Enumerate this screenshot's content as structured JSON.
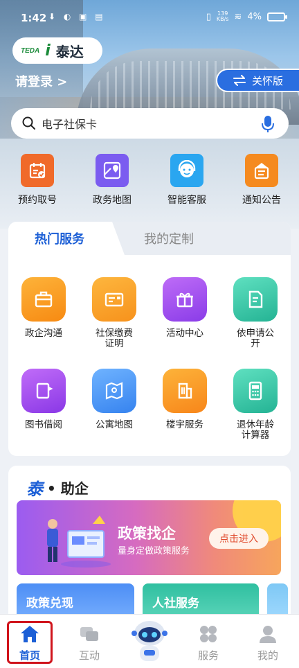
{
  "status_bar": {
    "time": "1:42",
    "network_speed": "139\nKB/s",
    "battery": "4%"
  },
  "header": {
    "logo_text": "TEDA",
    "app_name": "泰达",
    "login_text": "请登录 >",
    "care_mode_label": "关怀版"
  },
  "search": {
    "placeholder": "电子社保卡"
  },
  "quick_actions": [
    {
      "label": "预约取号",
      "icon": "calendar-check-icon",
      "color": "#f06a2a"
    },
    {
      "label": "政务地图",
      "icon": "map-pin-icon",
      "color": "#7b5cf0"
    },
    {
      "label": "智能客服",
      "icon": "headset-icon",
      "color": "#2aa6f0"
    },
    {
      "label": "通知公告",
      "icon": "notice-icon",
      "color": "#f58a1f"
    }
  ],
  "services": {
    "tabs": [
      "热门服务",
      "我的定制"
    ],
    "items": [
      {
        "label": "政企沟通",
        "icon": "briefcase-icon",
        "color": "#f89a1e"
      },
      {
        "label": "社保缴费\n证明",
        "icon": "card-icon",
        "color": "#f8a02a"
      },
      {
        "label": "活动中心",
        "icon": "gift-icon",
        "color": "#a24cf0"
      },
      {
        "label": "依申请公\n开",
        "icon": "document-icon",
        "color": "#36c9a8"
      },
      {
        "label": "图书借阅",
        "icon": "book-icon",
        "color": "#a04cf0"
      },
      {
        "label": "公寓地图",
        "icon": "map-icon",
        "color": "#3b8cf5"
      },
      {
        "label": "楼宇服务",
        "icon": "building-icon",
        "color": "#f8921e"
      },
      {
        "label": "退休年龄\n计算器",
        "icon": "calculator-icon",
        "color": "#2fbfa5"
      }
    ]
  },
  "assist": {
    "brand": "泰",
    "title": "• 助企",
    "banner": {
      "title": "政策找企",
      "subtitle": "量身定做政策服务",
      "cta": "点击进入"
    },
    "cards": [
      "政策兑现",
      "人社服务"
    ]
  },
  "bottom_nav": [
    {
      "label": "首页",
      "icon": "home-icon",
      "active": true
    },
    {
      "label": "互动",
      "icon": "chat-icon",
      "active": false
    },
    {
      "label": "",
      "icon": "robot-icon",
      "active": false
    },
    {
      "label": "服务",
      "icon": "grid-icon",
      "active": false
    },
    {
      "label": "我的",
      "icon": "user-icon",
      "active": false
    }
  ],
  "colors": {
    "primary": "#1c5fd6",
    "highlight": "#d0141c"
  }
}
